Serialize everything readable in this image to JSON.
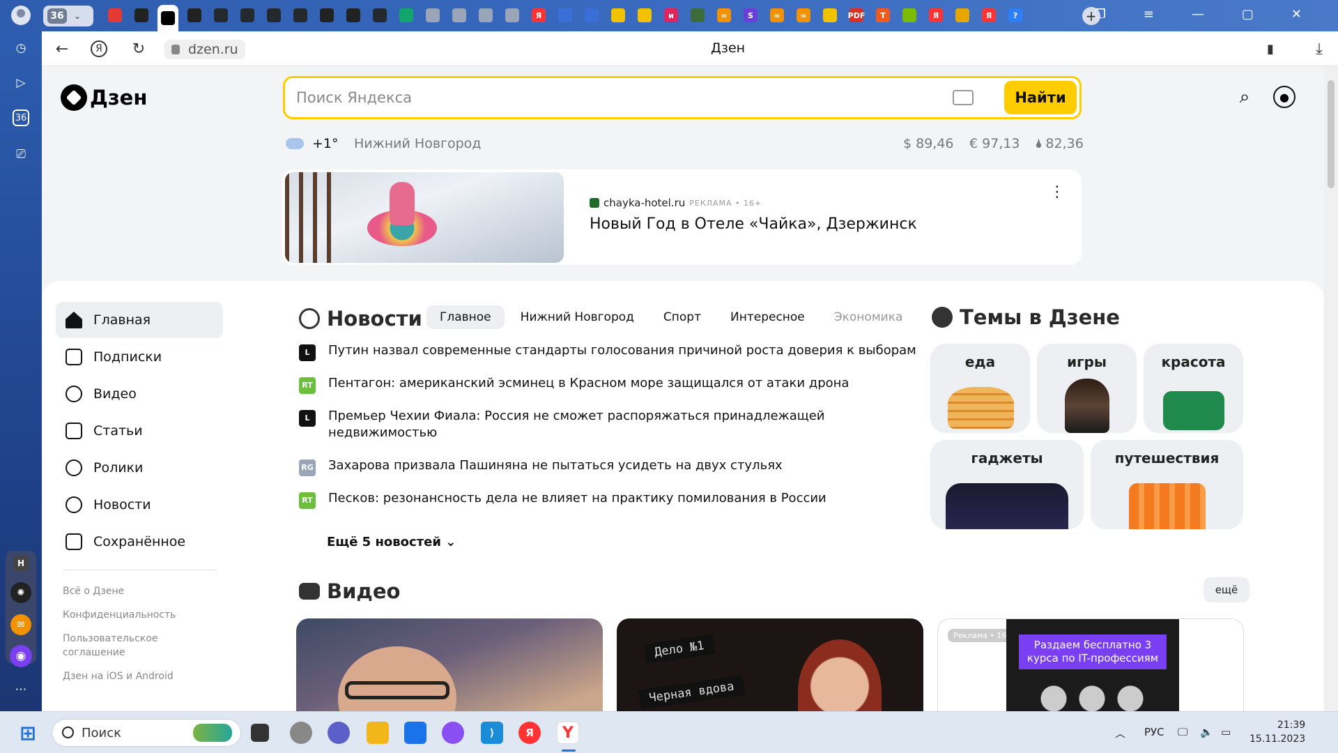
{
  "browser": {
    "tab_count": "36",
    "url": "dzen.ru",
    "page_title": "Дзен",
    "tab_icons": [
      {
        "name": "mail-tab-icon",
        "bg": "#e53935",
        "label": ""
      },
      {
        "name": "openai-tab-icon",
        "bg": "#222",
        "label": ""
      },
      {
        "name": "dzen-tab-icon",
        "bg": "#000",
        "label": ""
      },
      {
        "name": "openai-tab-icon-2",
        "bg": "#222",
        "label": ""
      },
      {
        "name": "github-tab-icon",
        "bg": "#24292e",
        "label": ""
      },
      {
        "name": "github-tab-icon-2",
        "bg": "#24292e",
        "label": ""
      },
      {
        "name": "github-tab-icon-3",
        "bg": "#24292e",
        "label": ""
      },
      {
        "name": "github-tab-icon-4",
        "bg": "#24292e",
        "label": ""
      },
      {
        "name": "openai-tab-icon-3",
        "bg": "#222",
        "label": ""
      },
      {
        "name": "openai-tab-icon-4",
        "bg": "#222",
        "label": ""
      },
      {
        "name": "github-tab-icon-5",
        "bg": "#24292e",
        "label": ""
      },
      {
        "name": "send-tab-icon",
        "bg": "#13a66b",
        "label": ""
      },
      {
        "name": "doc-tab-icon",
        "bg": "#9aa6b8",
        "label": ""
      },
      {
        "name": "doc-tab-icon-2",
        "bg": "#9aa6b8",
        "label": ""
      },
      {
        "name": "doc-tab-icon-3",
        "bg": "#9aa6b8",
        "label": ""
      },
      {
        "name": "doc-tab-icon-4",
        "bg": "#9aa6b8",
        "label": ""
      },
      {
        "name": "yandex-tab-icon",
        "bg": "#f33",
        "label": "Я"
      },
      {
        "name": "docs-tab-icon",
        "bg": "#3b6fd8",
        "label": ""
      },
      {
        "name": "docs-tab-icon-2",
        "bg": "#3b6fd8",
        "label": ""
      },
      {
        "name": "notes-tab-icon",
        "bg": "#f2c200",
        "label": ""
      },
      {
        "name": "notes-tab-icon-2",
        "bg": "#f2c200",
        "label": ""
      },
      {
        "name": "ivi-tab-icon",
        "bg": "#e0245e",
        "label": "и"
      },
      {
        "name": "tree-tab-icon",
        "bg": "#3e6b3a",
        "label": ""
      },
      {
        "name": "infinity-tab-icon",
        "bg": "#f29200",
        "label": "∞"
      },
      {
        "name": "s-tab-icon",
        "bg": "#6a3fd9",
        "label": "S"
      },
      {
        "name": "infinity-tab-icon-2",
        "bg": "#f29200",
        "label": "∞"
      },
      {
        "name": "infinity-tab-icon-3",
        "bg": "#f29200",
        "label": "∞"
      },
      {
        "name": "notes-tab-icon-3",
        "bg": "#f2c200",
        "label": ""
      },
      {
        "name": "pdf-tab-icon",
        "bg": "#d93025",
        "label": "PDF"
      },
      {
        "name": "t-tab-icon",
        "bg": "#f25a1d",
        "label": "T"
      },
      {
        "name": "ms-tab-icon",
        "bg": "#7cbb00",
        "label": ""
      },
      {
        "name": "yandex-tab-icon-2",
        "bg": "#f33",
        "label": "Я"
      },
      {
        "name": "image-tab-icon",
        "bg": "#e7a700",
        "label": ""
      },
      {
        "name": "yandex-tab-icon-3",
        "bg": "#f33",
        "label": "Я"
      },
      {
        "name": "help-tab-icon",
        "bg": "#2d7ff9",
        "label": "?"
      }
    ]
  },
  "header": {
    "logo_text": "Дзен",
    "search_placeholder": "Поиск Яндекса",
    "search_button": "Найти",
    "temperature": "+1°",
    "city": "Нижний Новгород",
    "usd": "$ 89,46",
    "eur": "€ 97,13",
    "oil": "82,36"
  },
  "ad": {
    "source": "chayka-hotel.ru",
    "tag": "РЕКЛАМА • 16+",
    "title": "Новый Год в Отеле «Чайка», Дзержинск"
  },
  "sidebar": {
    "items": [
      {
        "label": "Главная",
        "name": "nav-home"
      },
      {
        "label": "Подписки",
        "name": "nav-subscriptions"
      },
      {
        "label": "Видео",
        "name": "nav-video"
      },
      {
        "label": "Статьи",
        "name": "nav-articles"
      },
      {
        "label": "Ролики",
        "name": "nav-clips"
      },
      {
        "label": "Новости",
        "name": "nav-news"
      },
      {
        "label": "Сохранённое",
        "name": "nav-saved"
      }
    ],
    "links": [
      "Всё о Дзене",
      "Конфиденциальность",
      "Пользовательское соглашение",
      "Дзен на iOS и Android"
    ]
  },
  "news": {
    "title": "Новости",
    "tabs": [
      "Главное",
      "Нижний Новгород",
      "Спорт",
      "Интересное",
      "Экономика"
    ],
    "items": [
      {
        "source": "L",
        "color": "#111",
        "text": "Путин назвал современные стандарты голосования причиной роста доверия к выборам"
      },
      {
        "source": "RT",
        "color": "#6cbf3b",
        "text": "Пентагон: американский эсминец в Красном море защищался от атаки дрона"
      },
      {
        "source": "L",
        "color": "#111",
        "text": "Премьер Чехии Фиала: Россия не сможет распоряжаться принадлежащей недвижимостью"
      },
      {
        "source": "RG",
        "color": "#9aa6b8",
        "text": "Захарова призвала Пашиняна не пытаться усидеть на двух стульях"
      },
      {
        "source": "RT",
        "color": "#6cbf3b",
        "text": "Песков: резонансность дела не влияет на практику помилования в России"
      }
    ],
    "more": "Ещё 5 новостей"
  },
  "topics": {
    "title": "Темы в Дзене",
    "items": [
      "еда",
      "игры",
      "красота",
      "гаджеты",
      "путешествия"
    ]
  },
  "video": {
    "title": "Видео",
    "more": "ещё",
    "card2_text1": "Дело №1",
    "card2_text2": "Черная вдова",
    "ad_tag": "Реклама • 16+",
    "ad_banner": "Раздаем бесплатно 3 курса по IT-профессиям"
  },
  "taskbar": {
    "search": "Поиск",
    "lang": "РУС",
    "time": "21:39",
    "date": "15.11.2023"
  }
}
